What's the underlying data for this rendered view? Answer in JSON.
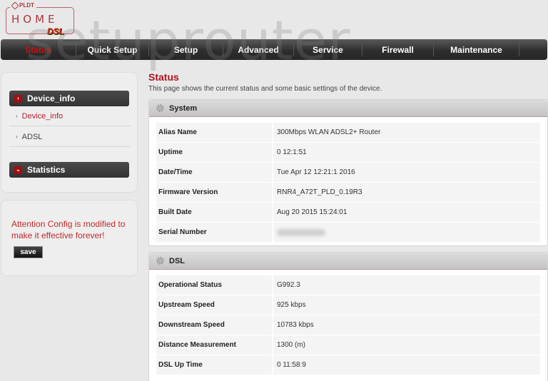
{
  "brand": {
    "company": "PLDT",
    "product": "HOME",
    "sub": "DSL"
  },
  "watermark": "setuprouter",
  "nav": {
    "items": [
      {
        "label": "Status",
        "active": true
      },
      {
        "label": "Quick Setup",
        "active": false
      },
      {
        "label": "Setup",
        "active": false
      },
      {
        "label": "Advanced",
        "active": false
      },
      {
        "label": "Service",
        "active": false
      },
      {
        "label": "Firewall",
        "active": false
      },
      {
        "label": "Maintenance",
        "active": false
      }
    ]
  },
  "sidebar": {
    "groups": [
      {
        "label": "Device_info",
        "icon": "chevron-right-icon",
        "expanded": true
      },
      {
        "label": "Statistics",
        "icon": "chevron-down-icon",
        "expanded": false
      }
    ],
    "items": [
      {
        "label": "Device_info",
        "active": true
      },
      {
        "label": "ADSL",
        "active": false
      }
    ]
  },
  "attention": {
    "message": "Attention Config is modified to make it effective forever!",
    "save_label": "save"
  },
  "page": {
    "title": "Status",
    "description": "This page shows the current status and some basic settings of the device."
  },
  "system": {
    "title": "System",
    "rows": [
      {
        "label": "Alias Name",
        "value": "300Mbps WLAN ADSL2+ Router"
      },
      {
        "label": "Uptime",
        "value": "0 12:1:51"
      },
      {
        "label": "Date/Time",
        "value": "Tue Apr 12 12:21:1 2016"
      },
      {
        "label": "Firmware Version",
        "value": "RNR4_A72T_PLD_0.19R3"
      },
      {
        "label": "Built Date",
        "value": "Aug 20 2015 15:24:01"
      },
      {
        "label": "Serial Number",
        "value": ""
      }
    ]
  },
  "dsl": {
    "title": "DSL",
    "rows": [
      {
        "label": "Operational Status",
        "value": "G992.3"
      },
      {
        "label": "Upstream Speed",
        "value": "925 kbps"
      },
      {
        "label": "Downstream Speed",
        "value": "10783 kbps"
      },
      {
        "label": "Distance Measurement",
        "value": "1300 (m)"
      },
      {
        "label": "DSL Up Time",
        "value": "0 11:58:9"
      }
    ]
  },
  "colors": {
    "accent_red": "#b01020",
    "nav_bg": "#2e2e2e"
  }
}
